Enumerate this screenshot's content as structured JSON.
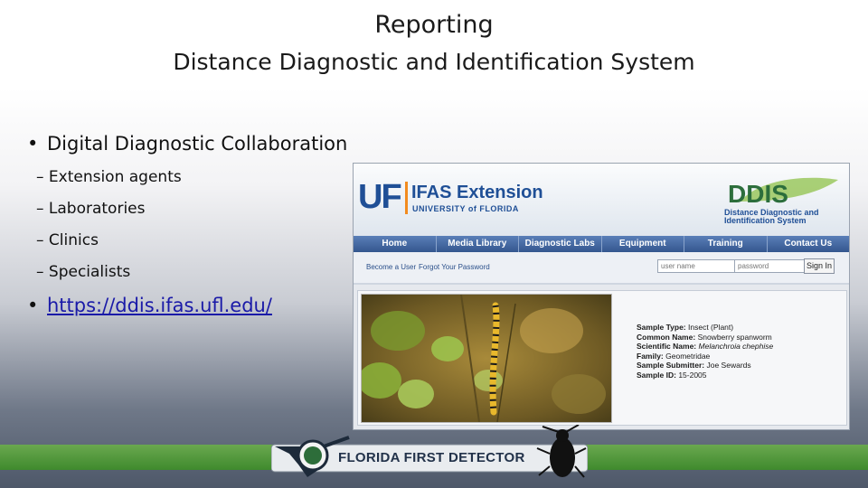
{
  "slide": {
    "title_line1": "Reporting",
    "title_line2": "Distance Diagnostic and Identification System"
  },
  "bullets": [
    {
      "text": "Digital Diagnostic Collaboration",
      "sub": [
        "– Extension agents",
        "– Laboratories",
        "– Clinics",
        "– Specialists"
      ]
    },
    {
      "text": "https://ddis.ifas.ufl.edu/"
    }
  ],
  "site": {
    "uf_logo": "UF",
    "org_title": "IFAS Extension",
    "org_subtitle": "UNIVERSITY of FLORIDA",
    "ddis_logo": "DDIS",
    "ddis_subtitle_1": "Distance Diagnostic and",
    "ddis_subtitle_2": "Identification System",
    "nav": [
      "Home",
      "Media Library",
      "Diagnostic Labs",
      "Equipment",
      "Training",
      "Contact Us"
    ],
    "login": {
      "become_user": "Become a User",
      "forgot_password": "Forgot Your Password",
      "username_placeholder": "user name",
      "password_placeholder": "password",
      "sign_in": "Sign In"
    },
    "sample": {
      "type_label": "Sample Type:",
      "type_value": "Insect (Plant)",
      "common_label": "Common Name:",
      "common_value": "Snowberry spanworm",
      "scientific_label": "Scientific Name:",
      "scientific_value": "Melanchroia chephise",
      "family_label": "Family:",
      "family_value": "Geometridae",
      "submitter_label": "Sample Submitter:",
      "submitter_value": "Joe Sewards",
      "id_label": "Sample ID:",
      "id_value": "15-2005"
    }
  },
  "footer": {
    "text": "FLORIDA FIRST DETECTOR"
  },
  "colors": {
    "link": "#1a1aa8",
    "uf_blue": "#1f4f96",
    "footer_green": "#4f9a3a"
  }
}
